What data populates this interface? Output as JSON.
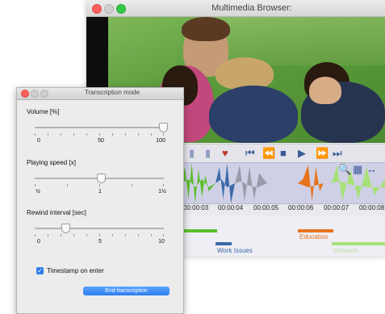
{
  "main_window": {
    "title": "Multimedia Browser:",
    "toolbar_icons": [
      "bookmark-icon",
      "bookmark-icon",
      "bookmark-icon",
      "skip-start-icon",
      "rewind-icon",
      "stop-icon",
      "step-forward-icon",
      "fast-forward-icon",
      "skip-end-icon",
      "zoom-in-icon",
      "fit-icon",
      "expand-icon"
    ],
    "timeline_labels": [
      "00:00:03",
      "00:00:04",
      "00:00:05",
      "00:00:06",
      "00:00:07",
      "00:00:08"
    ],
    "annotations": [
      {
        "label": "Work Issues",
        "color": "#3b6ba8"
      },
      {
        "label": "Education",
        "color": "#e8731c"
      },
      {
        "label": "Interests",
        "color": "#7fc241"
      }
    ]
  },
  "dialog": {
    "title": "Transcription mode",
    "volume": {
      "label": "Volume [%]",
      "value": 100,
      "ticks": [
        "0",
        "50",
        "100"
      ]
    },
    "speed": {
      "label": "Playing speed [x]",
      "value": 1,
      "ticks": [
        "½",
        "1",
        "1½"
      ]
    },
    "rewind": {
      "label": "Rewind interval [sec]",
      "value": 2.5,
      "ticks": [
        "0",
        "5",
        "10"
      ]
    },
    "timestamp": {
      "label": "Timestamp on enter",
      "checked": true
    },
    "end_button": "End transcription"
  },
  "colors": {
    "accent": "#2f7fe8",
    "waveform_green": "#5bbf2b",
    "waveform_blue": "#3b6ba8",
    "waveform_grey": "#9a9aaa",
    "waveform_orange": "#e8731c"
  }
}
